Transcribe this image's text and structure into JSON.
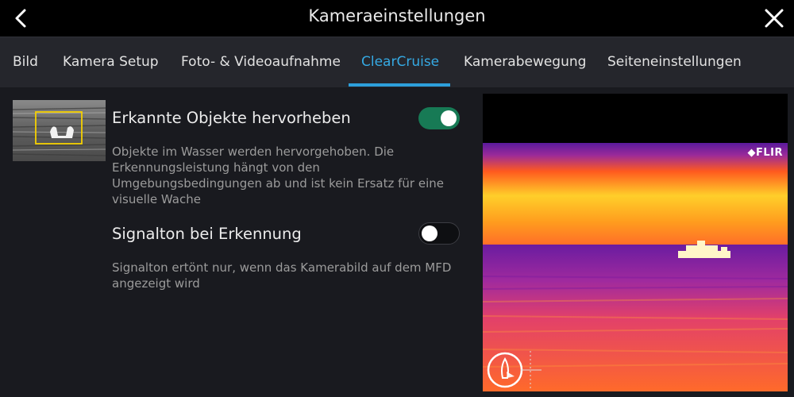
{
  "header": {
    "title": "Kameraeinstellungen",
    "back_icon": "chevron-left-icon",
    "close_icon": "close-icon"
  },
  "tabs": [
    {
      "label": "Bild"
    },
    {
      "label": "Kamera Setup"
    },
    {
      "label": "Foto- & Videoaufnahme"
    },
    {
      "label": "ClearCruise",
      "active": true
    },
    {
      "label": "Kamerabewegung"
    },
    {
      "label": "Seiteneinstellungen"
    }
  ],
  "settings": {
    "highlight": {
      "title": "Erkannte Objekte hervorheben",
      "description": "Objekte im Wasser werden hervorgehoben.  Die Erkennungsleistung hängt von den Umgebungsbedingungen ab und ist kein Ersatz für eine visuelle Wache",
      "enabled": true
    },
    "alarm": {
      "title": "Signalton bei Erkennung",
      "description": "Signalton ertönt nur, wenn das Kamerabild auf dem MFD angezeigt wird",
      "enabled": false
    }
  },
  "preview": {
    "logo_text": "FLIR"
  },
  "colors": {
    "accent": "#35a9e3",
    "toggle_on": "#177a55",
    "background": "#191a1f",
    "tabbar": "#25262c"
  }
}
